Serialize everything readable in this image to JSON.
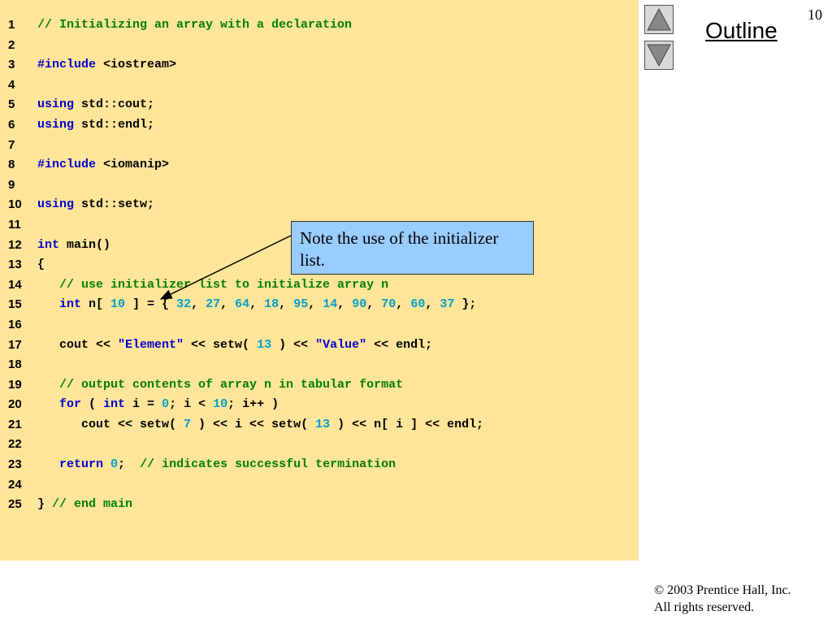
{
  "slide": {
    "page_number": "10",
    "outline_label": "Outline",
    "callout_text": "Note the use of the initializer list.",
    "copyright_line1": "© 2003 Prentice Hall, Inc.",
    "copyright_line2": "All rights reserved."
  },
  "nav": {
    "up_icon": "triangle-up-icon",
    "down_icon": "triangle-down-icon"
  },
  "colors": {
    "code_background": "#ffe59a",
    "keyword": "#0000cc",
    "comment": "#008000",
    "number": "#00a0c8",
    "callout_background": "#99ccff"
  },
  "code": [
    {
      "num": "1",
      "tokens": [
        {
          "t": "// Initializing an array with a declaration",
          "c": "comment"
        }
      ]
    },
    {
      "num": "2",
      "tokens": []
    },
    {
      "num": "3",
      "tokens": [
        {
          "t": "#include ",
          "c": "keyword"
        },
        {
          "t": "<iostream>",
          "c": "plain"
        }
      ]
    },
    {
      "num": "4",
      "tokens": []
    },
    {
      "num": "5",
      "tokens": [
        {
          "t": "using",
          "c": "keyword"
        },
        {
          "t": " std::cout;",
          "c": "plain"
        }
      ]
    },
    {
      "num": "6",
      "tokens": [
        {
          "t": "using",
          "c": "keyword"
        },
        {
          "t": " std::endl;",
          "c": "plain"
        }
      ]
    },
    {
      "num": "7",
      "tokens": []
    },
    {
      "num": "8",
      "tokens": [
        {
          "t": "#include ",
          "c": "keyword"
        },
        {
          "t": "<iomanip>",
          "c": "plain"
        }
      ]
    },
    {
      "num": "9",
      "tokens": []
    },
    {
      "num": "10",
      "tokens": [
        {
          "t": "using",
          "c": "keyword"
        },
        {
          "t": " std::setw;",
          "c": "plain"
        }
      ]
    },
    {
      "num": "11",
      "tokens": []
    },
    {
      "num": "12",
      "tokens": [
        {
          "t": "int",
          "c": "keyword"
        },
        {
          "t": " main()",
          "c": "plain"
        }
      ]
    },
    {
      "num": "13",
      "tokens": [
        {
          "t": "{",
          "c": "plain"
        }
      ]
    },
    {
      "num": "14",
      "tokens": [
        {
          "t": "   // use initializer list to initialize array n",
          "c": "comment"
        }
      ]
    },
    {
      "num": "15",
      "tokens": [
        {
          "t": "   int",
          "c": "keyword"
        },
        {
          "t": " n[ ",
          "c": "plain"
        },
        {
          "t": "10",
          "c": "number"
        },
        {
          "t": " ] = { ",
          "c": "plain"
        },
        {
          "t": "32",
          "c": "number"
        },
        {
          "t": ", ",
          "c": "plain"
        },
        {
          "t": "27",
          "c": "number"
        },
        {
          "t": ", ",
          "c": "plain"
        },
        {
          "t": "64",
          "c": "number"
        },
        {
          "t": ", ",
          "c": "plain"
        },
        {
          "t": "18",
          "c": "number"
        },
        {
          "t": ", ",
          "c": "plain"
        },
        {
          "t": "95",
          "c": "number"
        },
        {
          "t": ", ",
          "c": "plain"
        },
        {
          "t": "14",
          "c": "number"
        },
        {
          "t": ", ",
          "c": "plain"
        },
        {
          "t": "90",
          "c": "number"
        },
        {
          "t": ", ",
          "c": "plain"
        },
        {
          "t": "70",
          "c": "number"
        },
        {
          "t": ", ",
          "c": "plain"
        },
        {
          "t": "60",
          "c": "number"
        },
        {
          "t": ", ",
          "c": "plain"
        },
        {
          "t": "37",
          "c": "number"
        },
        {
          "t": " };",
          "c": "plain"
        }
      ]
    },
    {
      "num": "16",
      "tokens": []
    },
    {
      "num": "17",
      "tokens": [
        {
          "t": "   cout << ",
          "c": "plain"
        },
        {
          "t": "\"Element\"",
          "c": "string"
        },
        {
          "t": " << setw( ",
          "c": "plain"
        },
        {
          "t": "13",
          "c": "number"
        },
        {
          "t": " ) << ",
          "c": "plain"
        },
        {
          "t": "\"Value\"",
          "c": "string"
        },
        {
          "t": " << endl;",
          "c": "plain"
        }
      ]
    },
    {
      "num": "18",
      "tokens": []
    },
    {
      "num": "19",
      "tokens": [
        {
          "t": "   // output contents of array n in tabular format",
          "c": "comment"
        }
      ]
    },
    {
      "num": "20",
      "tokens": [
        {
          "t": "   for",
          "c": "keyword"
        },
        {
          "t": " ( ",
          "c": "plain"
        },
        {
          "t": "int",
          "c": "keyword"
        },
        {
          "t": " i = ",
          "c": "plain"
        },
        {
          "t": "0",
          "c": "number"
        },
        {
          "t": "; i < ",
          "c": "plain"
        },
        {
          "t": "10",
          "c": "number"
        },
        {
          "t": "; i++ )",
          "c": "plain"
        }
      ]
    },
    {
      "num": "21",
      "tokens": [
        {
          "t": "      cout << setw( ",
          "c": "plain"
        },
        {
          "t": "7",
          "c": "number"
        },
        {
          "t": " ) << i << setw( ",
          "c": "plain"
        },
        {
          "t": "13",
          "c": "number"
        },
        {
          "t": " ) << n[ i ] << endl;",
          "c": "plain"
        }
      ]
    },
    {
      "num": "22",
      "tokens": []
    },
    {
      "num": "23",
      "tokens": [
        {
          "t": "   return",
          "c": "keyword"
        },
        {
          "t": " ",
          "c": "plain"
        },
        {
          "t": "0",
          "c": "number"
        },
        {
          "t": ";  ",
          "c": "plain"
        },
        {
          "t": "// indicates successful termination",
          "c": "comment"
        }
      ]
    },
    {
      "num": "24",
      "tokens": []
    },
    {
      "num": "25",
      "tokens": [
        {
          "t": "} ",
          "c": "plain"
        },
        {
          "t": "// end main",
          "c": "comment"
        }
      ]
    }
  ]
}
